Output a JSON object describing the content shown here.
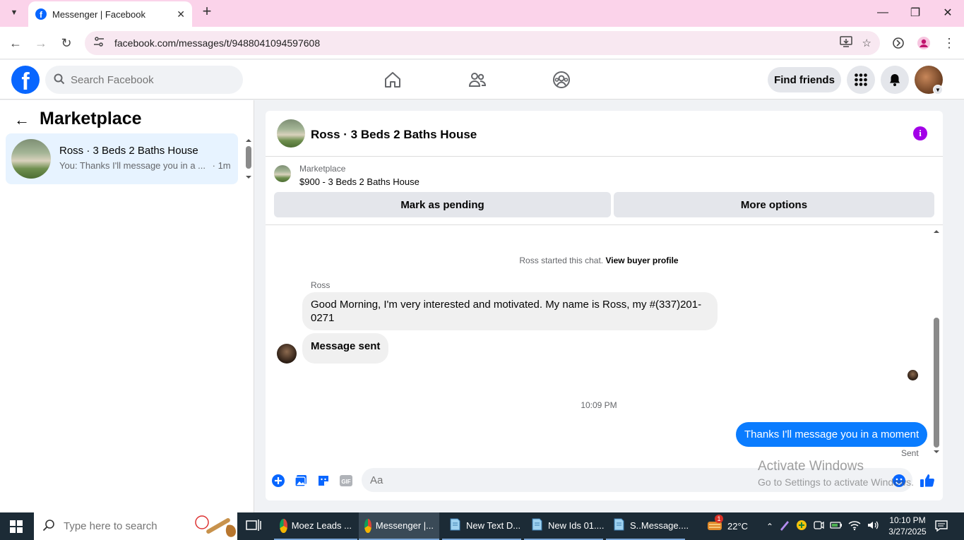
{
  "browser": {
    "tab_title": "Messenger | Facebook",
    "url": "facebook.com/messages/t/9488041094597608"
  },
  "facebook": {
    "search_placeholder": "Search Facebook",
    "find_friends": "Find friends"
  },
  "sidebar": {
    "title": "Marketplace",
    "conversations": [
      {
        "name": "Ross · 3 Beds 2 Baths House",
        "preview": "You: Thanks I'll message you in a ...",
        "time": "· 1m"
      }
    ]
  },
  "chat": {
    "title": "Ross · 3 Beds 2 Baths House",
    "marketplace_label": "Marketplace",
    "listing": "$900 - 3 Beds 2 Baths House",
    "mark_pending": "Mark as pending",
    "more_options": "More options",
    "started_text": "Ross started this chat.",
    "view_profile": "View buyer profile",
    "sender": "Ross",
    "messages_in": [
      "Good Morning, I'm very interested and motivated. My name is Ross, my #(337)201-0271",
      "Message sent"
    ],
    "timestamp": "10:09 PM",
    "message_out": "Thanks I'll message you in a moment",
    "status": "Sent",
    "composer_placeholder": "Aa"
  },
  "watermark": {
    "line1": "Activate Windows",
    "line2": "Go to Settings to activate Windows."
  },
  "taskbar": {
    "search_placeholder": "Type here to search",
    "apps": [
      "Moez Leads ...",
      "Messenger |...",
      "New Text D...",
      "New Ids 01....",
      "S..Message...."
    ],
    "weather": "22°C",
    "time": "10:10 PM",
    "date": "3/27/2025",
    "notification_count": "1"
  },
  "colors": {
    "facebook_blue": "#0866ff",
    "outgoing_bubble": "#0a7cff",
    "info_purple": "#a200e8",
    "tab_strip": "#fbd3ea"
  }
}
